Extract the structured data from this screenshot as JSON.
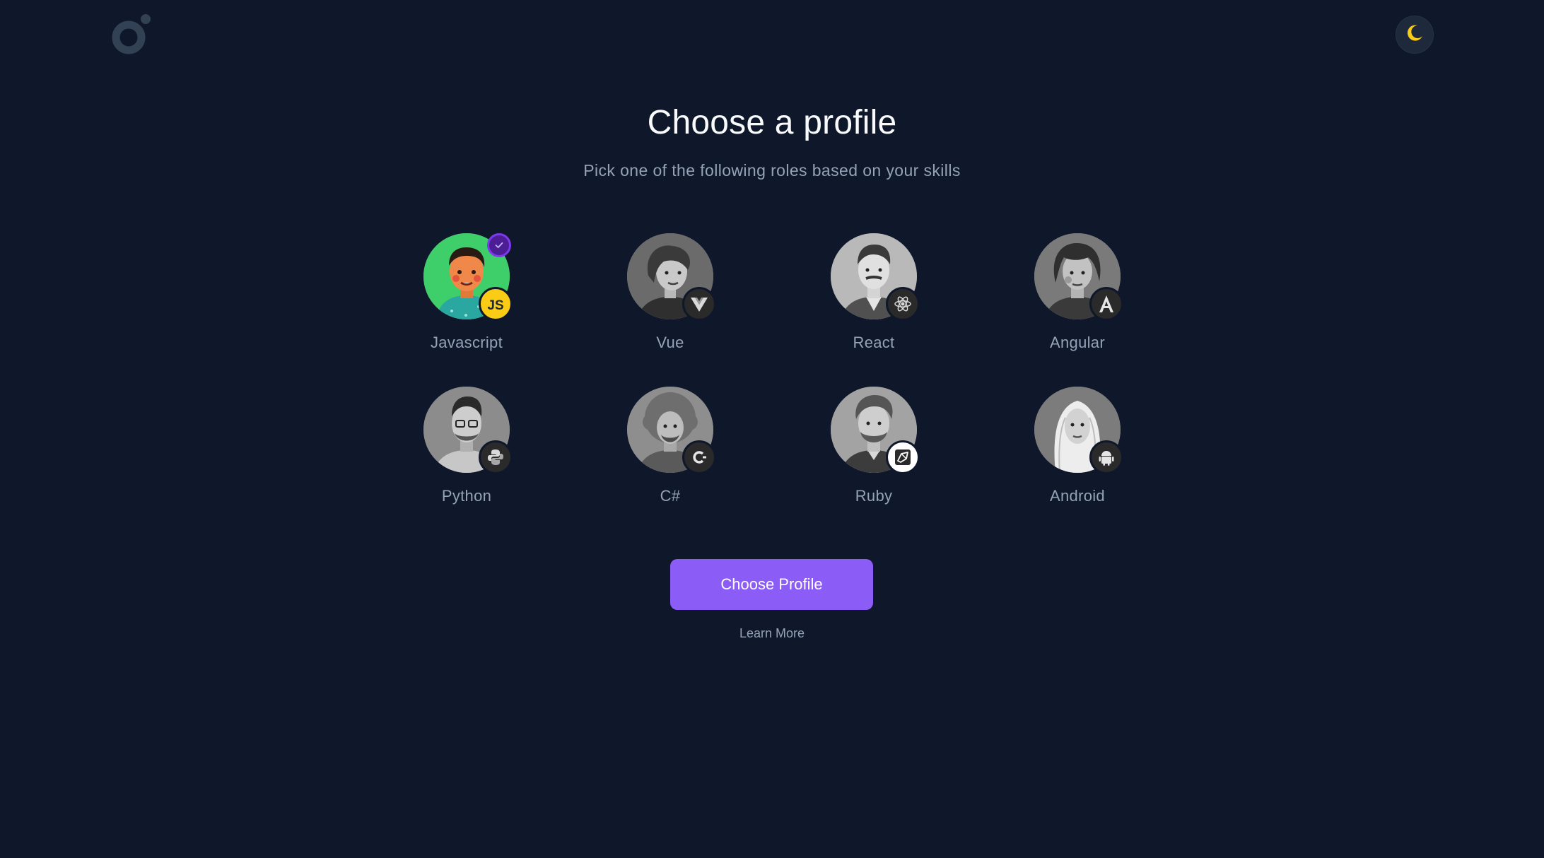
{
  "header": {
    "logo_icon": "brand-logo-icon",
    "theme_toggle_icon": "moon-icon",
    "accent_color": "#facc15"
  },
  "main": {
    "title": "Choose a profile",
    "subtitle": "Pick one of the following roles based on your skills",
    "profiles": [
      {
        "label": "Javascript",
        "badge_icon": "javascript-icon",
        "selected": true
      },
      {
        "label": "Vue",
        "badge_icon": "vue-icon",
        "selected": false
      },
      {
        "label": "React",
        "badge_icon": "react-icon",
        "selected": false
      },
      {
        "label": "Angular",
        "badge_icon": "angular-icon",
        "selected": false
      },
      {
        "label": "Python",
        "badge_icon": "python-icon",
        "selected": false
      },
      {
        "label": "C#",
        "badge_icon": "csharp-icon",
        "selected": false
      },
      {
        "label": "Ruby",
        "badge_icon": "ruby-icon",
        "selected": false
      },
      {
        "label": "Android",
        "badge_icon": "android-icon",
        "selected": false
      }
    ],
    "selected_badge_icon": "check-icon",
    "primary_button": "Choose Profile",
    "secondary_link": "Learn More",
    "colors": {
      "background": "#0f172a",
      "primary": "#8b5cf6",
      "selected_avatar_bg": "#3ecf6b",
      "muted_text": "#94a3b8"
    }
  }
}
